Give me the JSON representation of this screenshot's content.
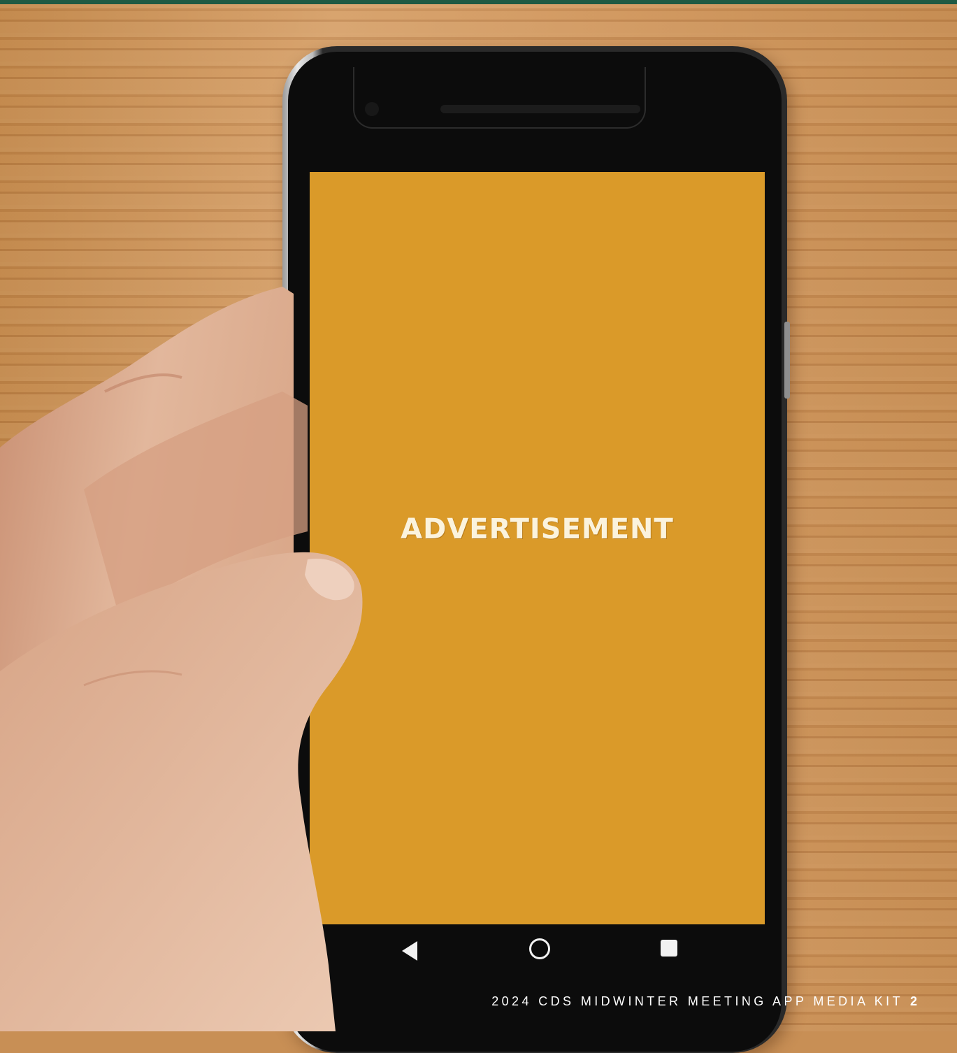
{
  "screen": {
    "ad_label": "ADVERTISEMENT",
    "background_color": "#da9a29"
  },
  "navigation": {
    "back_icon": "back-triangle",
    "home_icon": "home-circle",
    "recents_icon": "recents-square"
  },
  "footer": {
    "title": "2024 CDS MIDWINTER MEETING APP MEDIA KIT",
    "page_number": "2"
  },
  "colors": {
    "top_bar": "#1f5a43",
    "wood": "#c88f55"
  }
}
